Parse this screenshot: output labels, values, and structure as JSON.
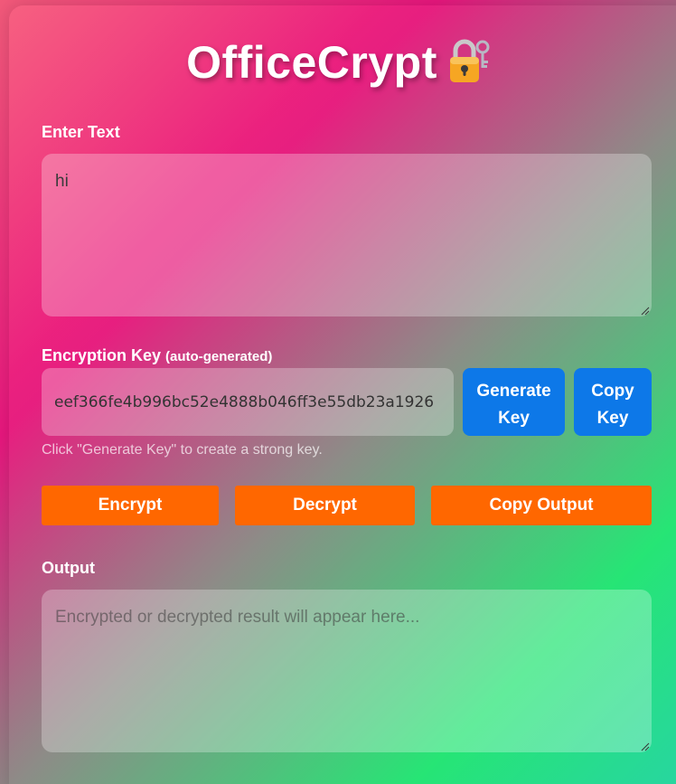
{
  "app": {
    "title": "OfficeCrypt"
  },
  "input_section": {
    "label": "Enter Text",
    "value": "hi"
  },
  "key_section": {
    "label": "Encryption Key",
    "label_note": "(auto-generated)",
    "value": "eef366fe4b996bc52e4888b046ff3e55db23a1926",
    "generate_button": "Generate Key",
    "copy_button": "Copy Key",
    "hint": "Click \"Generate Key\" to create a strong key."
  },
  "actions": {
    "encrypt": "Encrypt",
    "decrypt": "Decrypt",
    "copy_output": "Copy Output"
  },
  "output_section": {
    "label": "Output",
    "placeholder": "Encrypted or decrypted result will appear here..."
  },
  "colors": {
    "primary_button": "#0d78e8",
    "action_button": "#ff6700"
  },
  "icons": {
    "title_icon": "lock-with-key-icon"
  }
}
